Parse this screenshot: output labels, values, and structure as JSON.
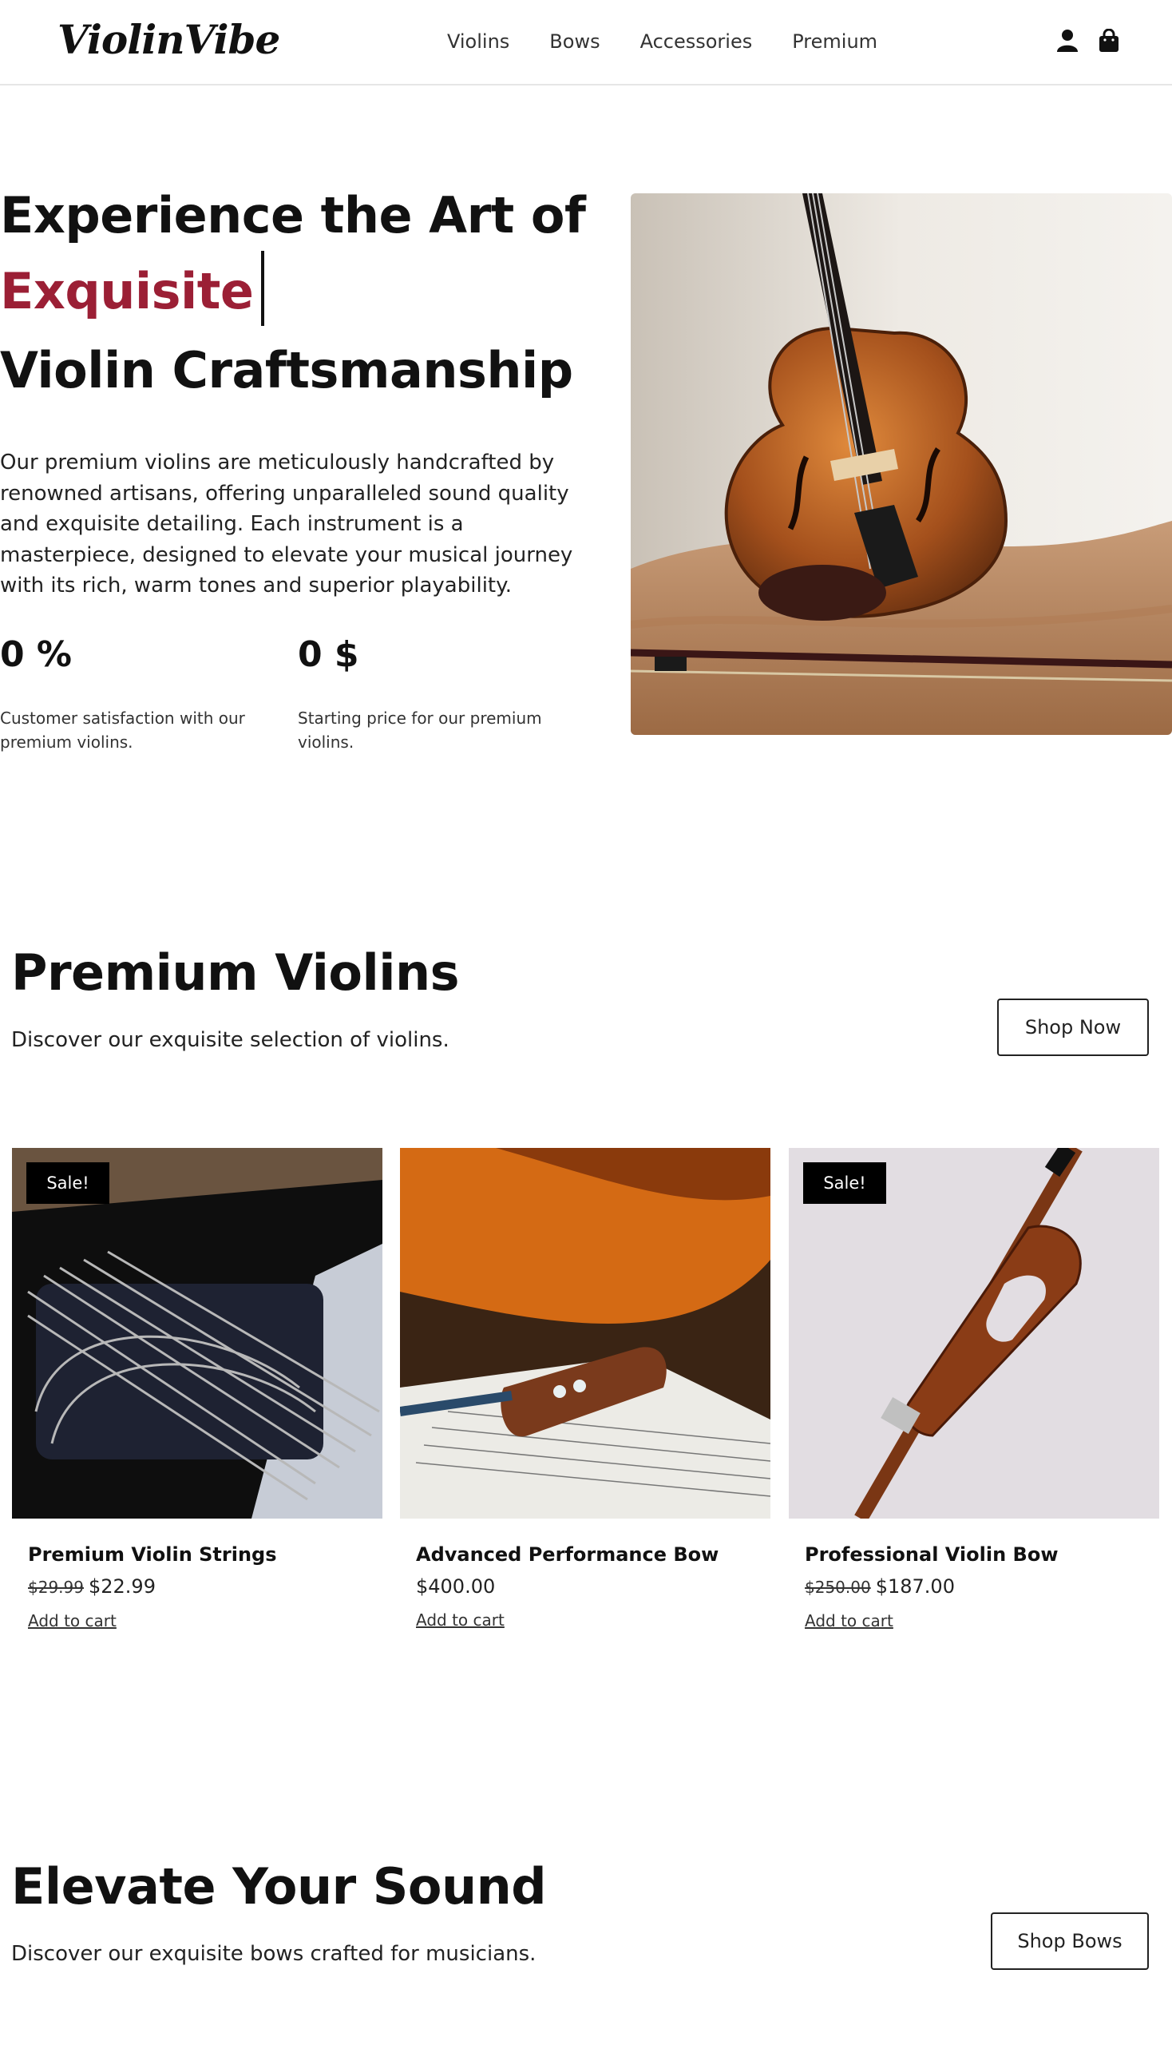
{
  "header": {
    "logo": "ViolinVibe",
    "nav": [
      "Violins",
      "Bows",
      "Accessories",
      "Premium"
    ],
    "icons": [
      "user-icon",
      "shopping-bag-icon"
    ]
  },
  "hero": {
    "title_line1": "Experience the Art of",
    "title_accent": "Exquisite",
    "title_line3": "Violin Craftsmanship",
    "description": "Our premium violins are meticulously handcrafted by renowned artisans, offering unparalleled sound quality and exquisite detailing. Each instrument is a masterpiece, designed to elevate your musical journey with its rich, warm tones and superior playability.",
    "stats": [
      {
        "value": "0 %",
        "caption": "Customer satisfaction with our premium violins."
      },
      {
        "value": "0 $",
        "caption": "Starting price for our premium violins."
      }
    ],
    "accent_color": "#9b1f35"
  },
  "premium": {
    "title": "Premium Violins",
    "subtitle": "Discover our exquisite selection of violins.",
    "button": "Shop Now"
  },
  "products": [
    {
      "name": "Premium Violin Strings",
      "old_price": "$29.99",
      "price": "$22.99",
      "badge": "Sale!",
      "action": "Add to cart"
    },
    {
      "name": "Advanced Performance Bow",
      "old_price": "",
      "price": "$400.00",
      "badge": "",
      "action": "Add to cart"
    },
    {
      "name": "Professional Violin Bow",
      "old_price": "$250.00",
      "price": "$187.00",
      "badge": "Sale!",
      "action": "Add to cart"
    }
  ],
  "elevate": {
    "title": "Elevate Your Sound",
    "subtitle": "Discover our exquisite bows crafted for musicians.",
    "button": "Shop Bows"
  }
}
